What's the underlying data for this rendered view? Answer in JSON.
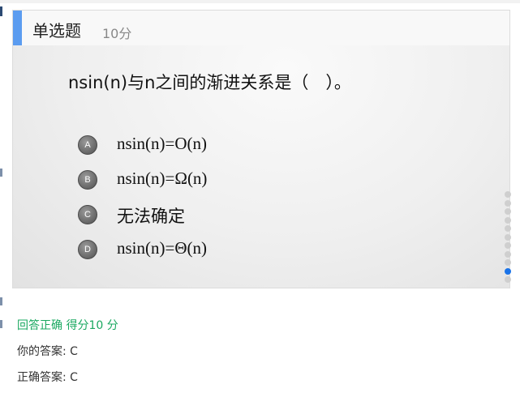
{
  "question": {
    "type_label": "单选题",
    "score_label": "10分",
    "prompt": "nsin(n)与n之间的渐进关系是（　）。",
    "options": [
      {
        "letter": "A",
        "text": "nsin(n)=O(n)"
      },
      {
        "letter": "B",
        "text": "nsin(n)=Ω(n)"
      },
      {
        "letter": "C",
        "text": "无法确定"
      },
      {
        "letter": "D",
        "text": "nsin(n)=Θ(n)"
      }
    ]
  },
  "pagination": {
    "total_dots": 11,
    "active_index": 9
  },
  "result": {
    "status": "回答正确 得分10 分",
    "your_answer": "你的答案: C",
    "correct_answer": "正确答案: C"
  },
  "colors": {
    "accent": "#5b9cf0",
    "success": "#1aa860",
    "active_dot": "#1a73e8"
  }
}
